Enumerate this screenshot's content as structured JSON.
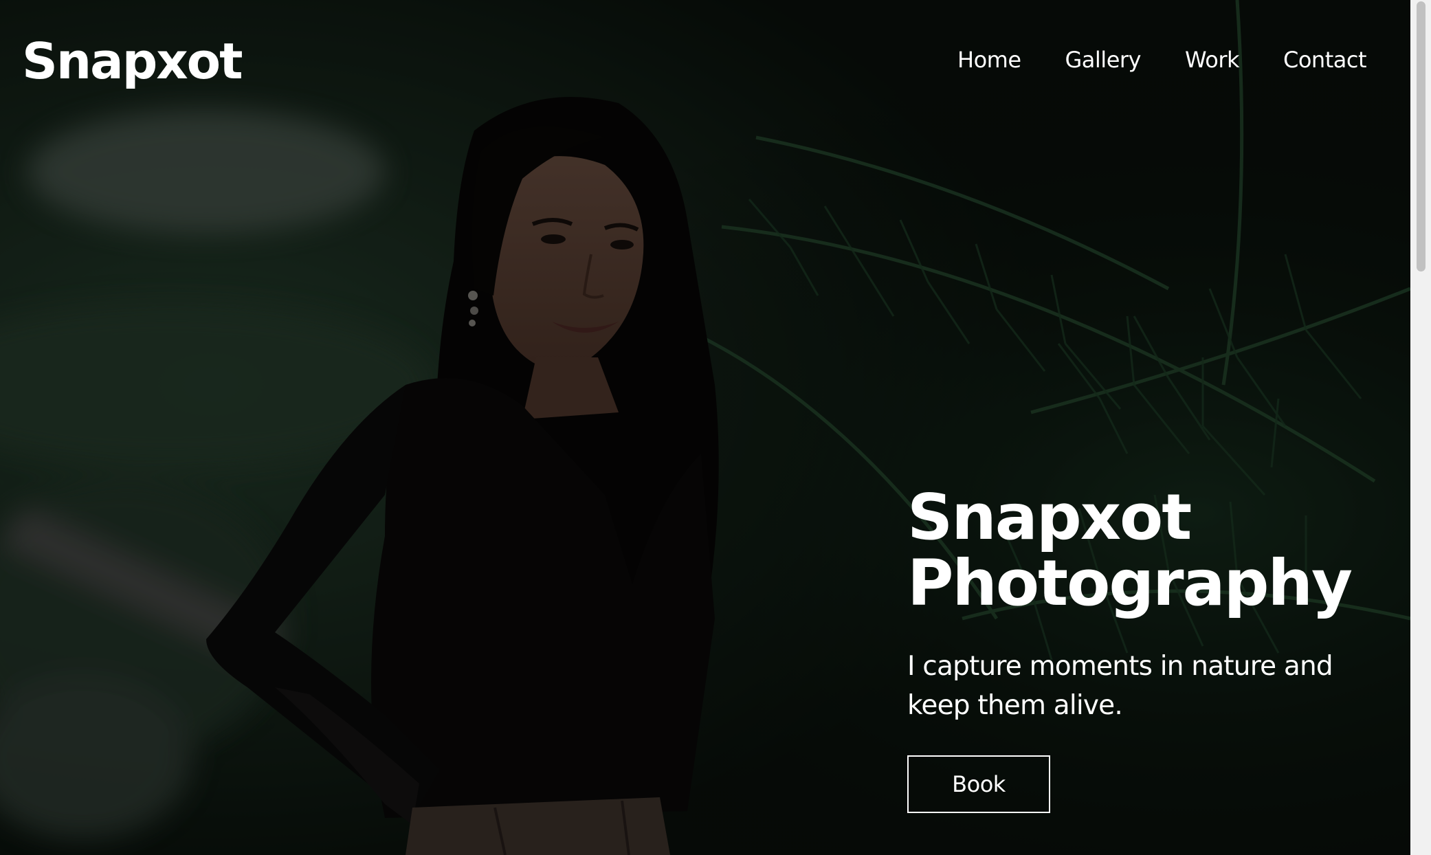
{
  "header": {
    "logo": "Snapxot",
    "nav": [
      {
        "label": "Home"
      },
      {
        "label": "Gallery"
      },
      {
        "label": "Work"
      },
      {
        "label": "Contact"
      }
    ]
  },
  "hero": {
    "title_line1": "Snapxot",
    "title_line2": "Photography",
    "subtitle": "I capture moments in nature and keep them alive.",
    "button_label": "Book",
    "image_subject": "woman-in-black-top-among-palm-leaves"
  },
  "colors": {
    "text": "#ffffff",
    "overlay": "#000000",
    "foliage": "#1f3a25",
    "scrollbar_track": "#f1f1f1",
    "scrollbar_thumb": "#c1c1c1"
  }
}
